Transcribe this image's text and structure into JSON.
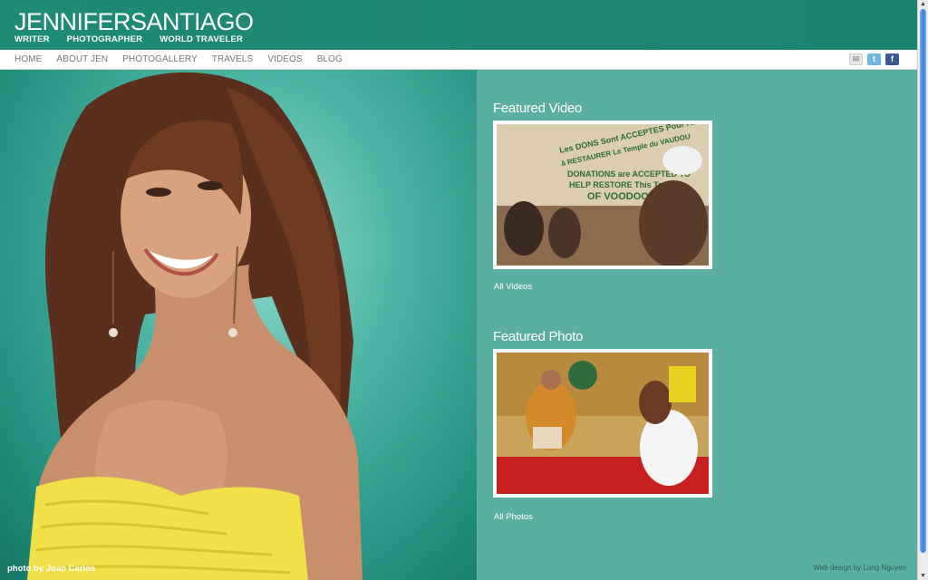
{
  "header": {
    "brand_first": "JENNIFER",
    "brand_last": "SANTIAGO",
    "roles": [
      "WRITER",
      "PHOTOGRAPHER",
      "WORLD TRAVELER"
    ]
  },
  "nav": {
    "items": [
      "HOME",
      "ABOUT JEN",
      "PHOTOGALLERY",
      "TRAVELS",
      "VIDEOS",
      "BLOG"
    ],
    "social_icons": [
      "mail-icon",
      "twitter-icon",
      "facebook-icon"
    ]
  },
  "hero": {
    "photo_credit": "photo by Joao Carlos"
  },
  "featured_video": {
    "title": "Featured Video",
    "sign_lines": [
      "Les DONS Sont ACCEPTES Pour AIDER",
      "à RESTAURER Le Temple du VAUDOU",
      "DONATIONS are ACCEPTED TO",
      "HELP RESTORE This Temple",
      "OF VOODOO"
    ],
    "link": "All Videos"
  },
  "featured_photo": {
    "title": "Featured Photo",
    "link": "All Photos"
  },
  "footer": {
    "design_credit": "Web design by Long Nguyen"
  },
  "colors": {
    "header": "#1f8a77",
    "right_panel": "#5aaea2",
    "nav_text": "#777777"
  }
}
